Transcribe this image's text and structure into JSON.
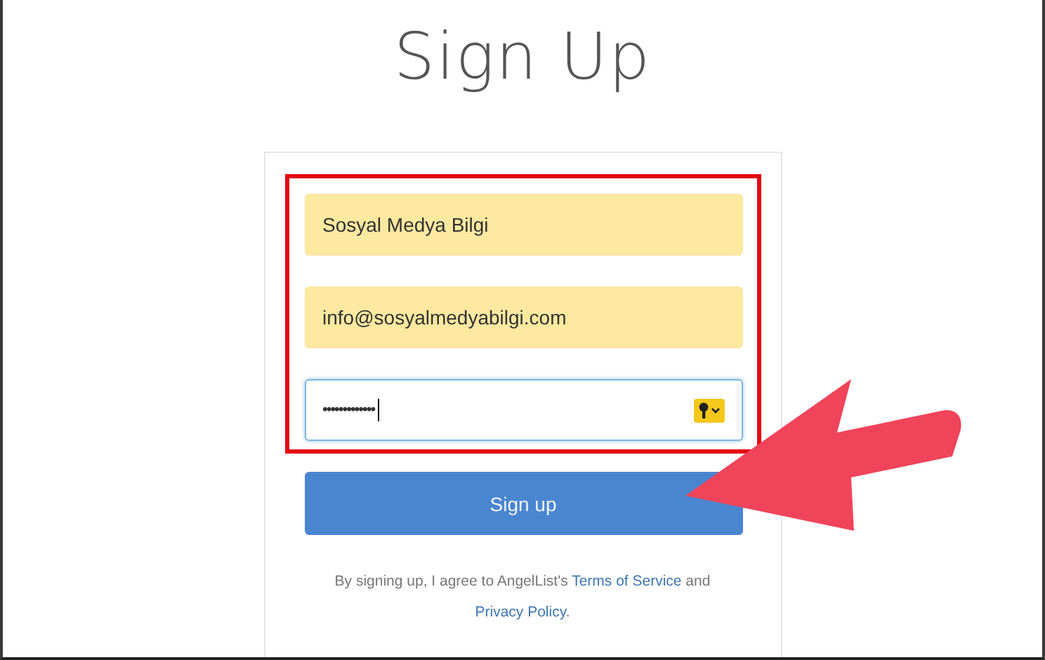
{
  "title": "Sign Up",
  "fields": [
    {
      "kind": "text",
      "value": "Sosyal Medya Bilgi",
      "autofilled": true
    },
    {
      "kind": "text",
      "value": "info@sosyalmedyabilgi.com",
      "autofilled": true
    },
    {
      "kind": "password",
      "value": "•••••••••••••",
      "autofilled": false
    }
  ],
  "button": "Sign up",
  "legal": {
    "before": "By signing up, I agree to AngelList's",
    "terms_link": "Terms of Service",
    "middle": "and",
    "privacy_link": "Privacy Policy",
    "after": "."
  }
}
